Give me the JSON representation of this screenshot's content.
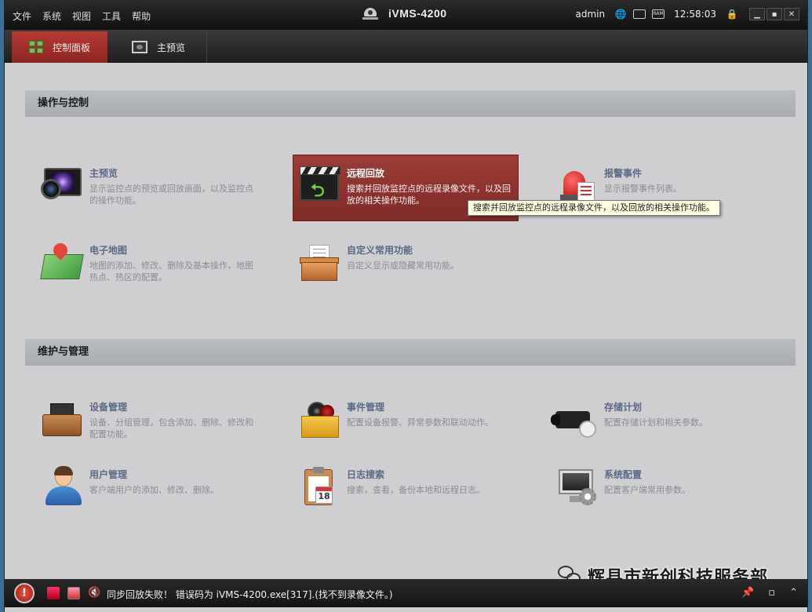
{
  "menu": [
    "文件",
    "系统",
    "视图",
    "工具",
    "帮助"
  ],
  "app_title": "iVMS-4200",
  "status": {
    "user": "admin",
    "time": "12:58:03",
    "ram_label": "RAM"
  },
  "tabs": [
    {
      "label": "控制面板",
      "active": true
    },
    {
      "label": "主预览",
      "active": false
    }
  ],
  "sections": {
    "ops": {
      "title": "操作与控制",
      "items": [
        {
          "name": "主预览",
          "desc": "显示监控点的预览或回放画面，以及监控点的操作功能。"
        },
        {
          "name": "远程回放",
          "desc": "搜索并回放监控点的远程录像文件，以及回放的相关操作功能。"
        },
        {
          "name": "报警事件",
          "desc": "显示报警事件列表。"
        },
        {
          "name": "电子地图",
          "desc": "地图的添加、修改、删除及基本操作，地图热点、热区的配置。"
        },
        {
          "name": "自定义常用功能",
          "desc": "自定义显示或隐藏常用功能。"
        }
      ]
    },
    "maint": {
      "title": "维护与管理",
      "items": [
        {
          "name": "设备管理",
          "desc": "设备、分组管理，包含添加、删除、修改和配置功能。"
        },
        {
          "name": "事件管理",
          "desc": "配置设备报警、异常参数和联动动作。"
        },
        {
          "name": "存储计划",
          "desc": "配置存储计划和相关参数。"
        },
        {
          "name": "用户管理",
          "desc": "客户端用户的添加、修改、删除。"
        },
        {
          "name": "日志搜索",
          "desc": "搜索，查看，备份本地和远程日志。"
        },
        {
          "name": "系统配置",
          "desc": "配置客户端常用参数。"
        }
      ]
    }
  },
  "tooltip": "搜索并回放监控点的远程录像文件，以及回放的相关操作功能。",
  "calendar_day": "18",
  "statusbar": {
    "message": "同步回放失败！ 错误码为 iVMS-4200.exe[317].(找不到录像文件。)"
  },
  "watermark": "辉县市新创科技服务部",
  "colors": {
    "accent_red": "#9d3b37",
    "title_link": "#5a6a86"
  }
}
